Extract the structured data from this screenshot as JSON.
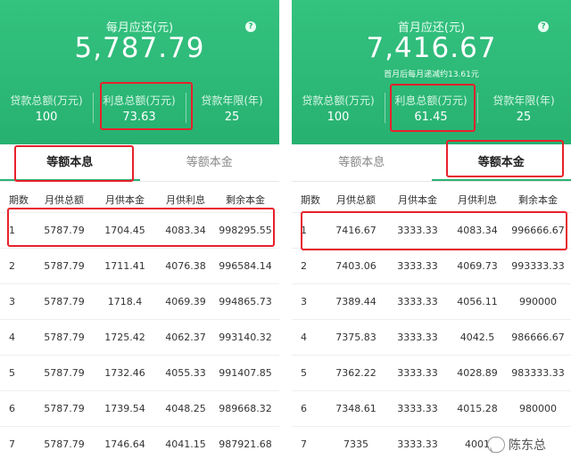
{
  "left": {
    "header": {
      "title": "每月应还(元)",
      "amount": "5,787.79",
      "stats": [
        {
          "label": "贷款总额(万元)",
          "value": "100"
        },
        {
          "label": "利息总额(万元)",
          "value": "73.63"
        },
        {
          "label": "贷款年限(年)",
          "value": "25"
        }
      ]
    },
    "tabs": [
      {
        "label": "等额本息",
        "active": true
      },
      {
        "label": "等额本金",
        "active": false
      }
    ],
    "columns": [
      "期数",
      "月供总额",
      "月供本金",
      "月供利息",
      "剩余本金"
    ],
    "rows": [
      [
        "1",
        "5787.79",
        "1704.45",
        "4083.34",
        "998295.55"
      ],
      [
        "2",
        "5787.79",
        "1711.41",
        "4076.38",
        "996584.14"
      ],
      [
        "3",
        "5787.79",
        "1718.4",
        "4069.39",
        "994865.73"
      ],
      [
        "4",
        "5787.79",
        "1725.42",
        "4062.37",
        "993140.32"
      ],
      [
        "5",
        "5787.79",
        "1732.46",
        "4055.33",
        "991407.85"
      ],
      [
        "6",
        "5787.79",
        "1739.54",
        "4048.25",
        "989668.32"
      ],
      [
        "7",
        "5787.79",
        "1746.64",
        "4041.15",
        "987921.68"
      ]
    ]
  },
  "right": {
    "header": {
      "title": "首月应还(元)",
      "amount": "7,416.67",
      "note": "首月后每月递减约13.61元",
      "stats": [
        {
          "label": "贷款总额(万元)",
          "value": "100"
        },
        {
          "label": "利息总额(万元)",
          "value": "61.45"
        },
        {
          "label": "贷款年限(年)",
          "value": "25"
        }
      ]
    },
    "tabs": [
      {
        "label": "等额本息",
        "active": false
      },
      {
        "label": "等额本金",
        "active": true
      }
    ],
    "columns": [
      "期数",
      "月供总额",
      "月供本金",
      "月供利息",
      "剩余本金"
    ],
    "rows": [
      [
        "1",
        "7416.67",
        "3333.33",
        "4083.34",
        "996666.67"
      ],
      [
        "2",
        "7403.06",
        "3333.33",
        "4069.73",
        "993333.33"
      ],
      [
        "3",
        "7389.44",
        "3333.33",
        "4056.11",
        "990000"
      ],
      [
        "4",
        "7375.83",
        "3333.33",
        "4042.5",
        "986666.67"
      ],
      [
        "5",
        "7362.22",
        "3333.33",
        "4028.89",
        "983333.33"
      ],
      [
        "6",
        "7348.61",
        "3333.33",
        "4015.28",
        "980000"
      ],
      [
        "7",
        "7335",
        "3333.33",
        "4001",
        ""
      ]
    ]
  },
  "icons": {
    "help": "question-circle-icon",
    "watermark": "chat-bubble-icon"
  },
  "colors": {
    "header_green": "#2bb374",
    "highlight_red": "#e8212b"
  },
  "watermark_text": "陈东总"
}
